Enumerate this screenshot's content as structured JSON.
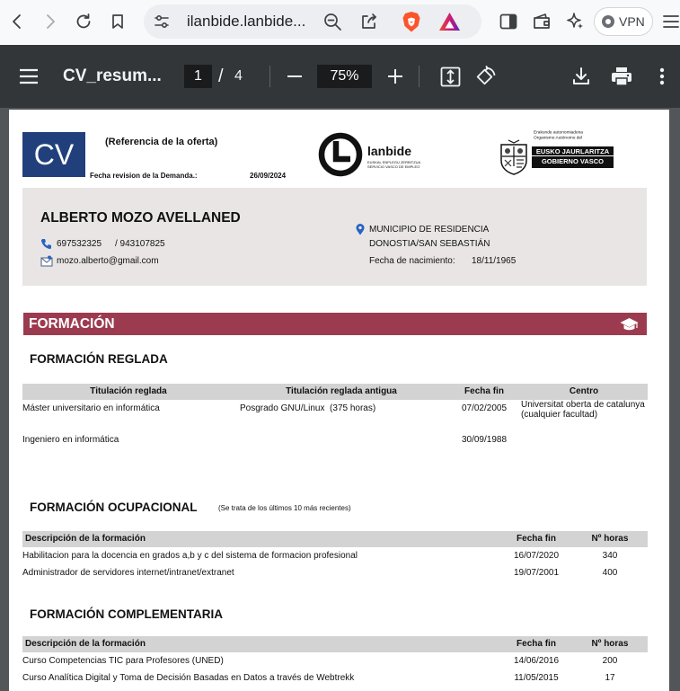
{
  "browser": {
    "url": "ilanbide.lanbide...",
    "vpn_label": "VPN",
    "icons": [
      "back-arrow-icon",
      "forward-arrow-icon",
      "reload-icon",
      "bookmark-icon",
      "site-settings-icon",
      "zoom-out-icon",
      "share-icon",
      "brave-shields-icon",
      "brave-rewards-icon",
      "sidebar-icon",
      "wallet-icon",
      "leo-ai-icon",
      "vpn-icon",
      "menu-icon"
    ]
  },
  "pdf_toolbar": {
    "title": "CV_resum...",
    "page_current": "1",
    "page_separator": "/",
    "page_total": "4",
    "zoom": "75%",
    "icons": [
      "hamburger-menu-icon",
      "zoom-minus-icon",
      "zoom-plus-icon",
      "fit-to-page-icon",
      "rotate-icon",
      "download-icon",
      "print-icon",
      "more-options-icon"
    ]
  },
  "doc": {
    "logo_text": "CV",
    "offer_reference": "(Referencia de la oferta)",
    "review_date_label": "Fecha revision de la Demanda.:",
    "review_date": "26/09/2024",
    "lanbide": {
      "name": "lanbide",
      "tagline_eu": "EUSKAL ENPLEGU ZERBITZUA",
      "tagline_es": "SERVICIO VASCO DE EMPLEO"
    },
    "gov": {
      "line1": "Erakunde autonomiadena",
      "line2": "Organismo Autónomo del",
      "name_eu": "EUSKO JAURLARITZA",
      "name_es": "GOBIERNO VASCO"
    },
    "profile": {
      "name": "ALBERTO MOZO AVELLANED",
      "phone": "697532325",
      "phone_alt": "/ 943107825",
      "email": "mozo.alberto@gmail.com",
      "residence_label": "MUNICIPIO DE RESIDENCIA",
      "residence": "DONOSTIA/SAN SEBASTIÁN",
      "birth_label": "Fecha de nacimiento:",
      "birth_date": "18/11/1965"
    },
    "section_title": "FORMACIÓN",
    "reglada": {
      "title": "FORMACIÓN REGLADA",
      "headers": [
        "Titulación reglada",
        "Titulación reglada antigua",
        "Fecha fin",
        "Centro"
      ],
      "rows": [
        {
          "title": "Máster universitario en informática",
          "old_title": "Posgrado GNU/Linux  (375 horas)",
          "end_date": "07/02/2005",
          "center": "Universitat oberta de catalunya (cualquier facultad)"
        },
        {
          "title": "Ingeniero en informática",
          "old_title": "",
          "end_date": "30/09/1988",
          "center": ""
        }
      ]
    },
    "ocupacional": {
      "title": "FORMACIÓN OCUPACIONAL",
      "note": "(Se trata de los últimos 10 más recientes)",
      "headers": [
        "Descripción de la formación",
        "Fecha fin",
        "Nº horas"
      ],
      "rows": [
        {
          "description": "Habilitacion para la docencia en grados a,b y c del sistema de formacion profesional",
          "end_date": "16/07/2020",
          "hours": "340"
        },
        {
          "description": "Administrador de servidores internet/intranet/extranet",
          "end_date": "19/07/2001",
          "hours": "400"
        }
      ]
    },
    "complementaria": {
      "title": "FORMACIÓN COMPLEMENTARIA",
      "headers": [
        "Descripción de la formación",
        "Fecha fin",
        "Nº horas"
      ],
      "rows": [
        {
          "description": "Curso Competencias TIC para Profesores (UNED)",
          "end_date": "14/06/2016",
          "hours": "200"
        },
        {
          "description": "Curso Analítica Digital y Toma de Decisión Basadas en Datos a través de Webtrekk",
          "end_date": "11/05/2015",
          "hours": "17"
        }
      ]
    }
  },
  "colors": {
    "pdf_toolbar": "#323639",
    "viewer_background": "#525659",
    "cv_logo": "#21407b",
    "profile_box": "#e9e5e5",
    "section_bar": "#9c3b4f",
    "table_header": "#d3d3d3",
    "icon_blue": "#2563c4",
    "brave_orange": "#fb542b"
  }
}
